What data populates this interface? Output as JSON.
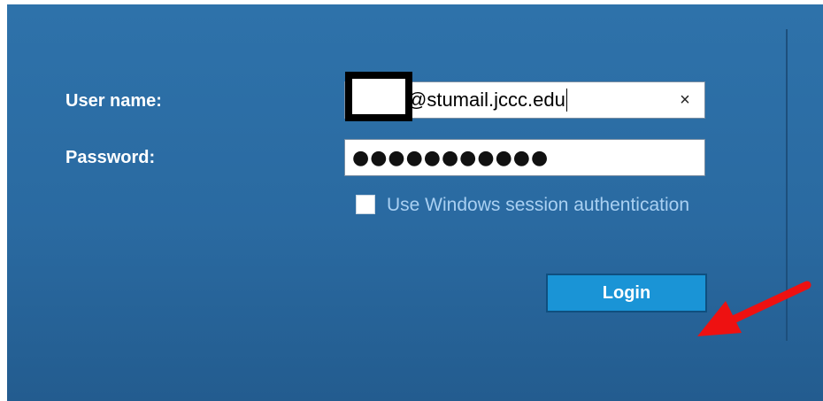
{
  "form": {
    "username_label": "User name:",
    "username_value": "@stumail.jccc.edu",
    "clear_icon": "×",
    "password_label": "Password:",
    "password_masked": "●●●●●●●●●●●",
    "windows_auth_label": "Use Windows session authentication",
    "windows_auth_checked": false,
    "login_label": "Login"
  },
  "icons": {
    "clear": "close-icon",
    "annotation": "red-arrow-annotation"
  },
  "colors": {
    "panel_background": "#2a6aa1",
    "label_text": "#ffffff",
    "checkbox_label_text": "#a9d0f2",
    "login_button": "#1a94d6",
    "annotation_arrow": "#ee1111"
  }
}
